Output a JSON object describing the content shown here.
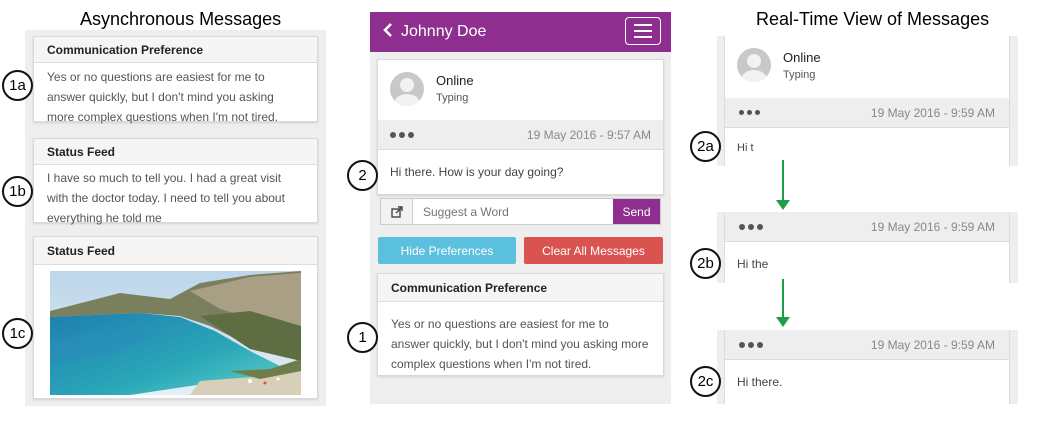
{
  "sections": {
    "async_title": "Asynchronous Messages",
    "realtime_title": "Real-Time View of Messages"
  },
  "labels": {
    "l1a": "1a",
    "l1b": "1b",
    "l1c": "1c",
    "l1": "1",
    "l2": "2",
    "l2a": "2a",
    "l2b": "2b",
    "l2c": "2c"
  },
  "left": {
    "card1": {
      "title": "Communication Preference",
      "body": "Yes or no questions are easiest for me to answer quickly, but I don't mind you asking more complex questions when I'm not tired."
    },
    "card2": {
      "title": "Status Feed",
      "body": "I have so much to tell you. I had a great visit with the doctor today. I need to tell you about everything he told me"
    },
    "card3": {
      "title": "Status Feed"
    }
  },
  "phone": {
    "header_title": "Johnny Doe",
    "status": "Online",
    "substatus": "Typing",
    "timestamp": "19 May 2016 - 9:57 AM",
    "message": "Hi there. How is your day going?",
    "input_placeholder": "Suggest a Word",
    "send_label": "Send",
    "hide_prefs_label": "Hide Preferences",
    "clear_label": "Clear All Messages",
    "pref_title": "Communication Preference",
    "pref_body": "Yes or no questions are easiest for me to answer quickly, but I don't mind you asking more complex questions when I'm not tired."
  },
  "realtime": {
    "status": "Online",
    "substatus": "Typing",
    "steps": [
      {
        "timestamp": "19 May 2016 - 9:59 AM",
        "text": "Hi t"
      },
      {
        "timestamp": "19 May 2016 - 9:59 AM",
        "text": "Hi the"
      },
      {
        "timestamp": "19 May 2016 - 9:59 AM",
        "text": "Hi there."
      }
    ]
  },
  "colors": {
    "header_purple": "#8e2f8f",
    "send_purple": "#8e2f8f",
    "hide_blue": "#5bc0de",
    "clear_red": "#d9534f",
    "arrow_green": "#1e9e4a"
  },
  "icons": {
    "back": "chevron-left-icon",
    "menu": "hamburger-menu-icon",
    "share": "share-icon"
  }
}
